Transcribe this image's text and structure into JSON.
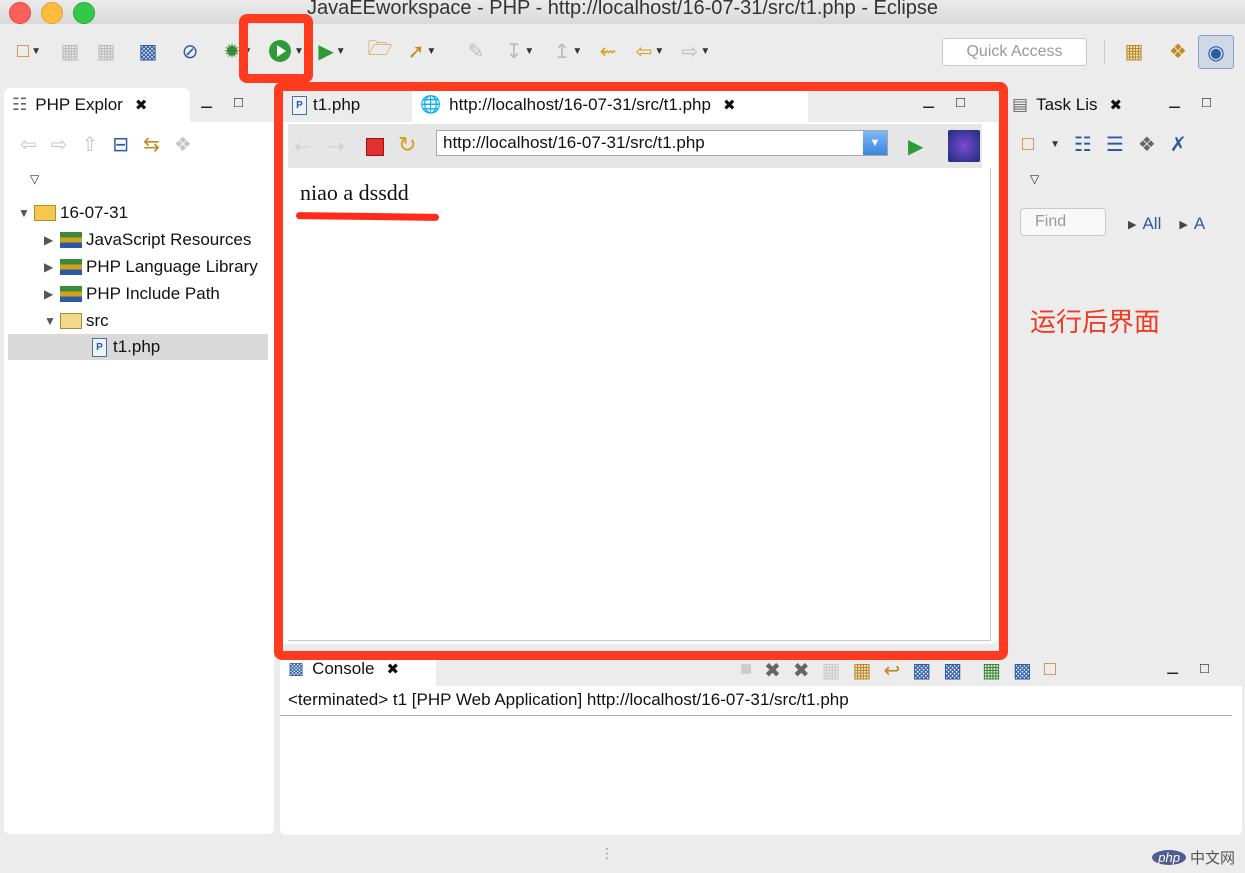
{
  "window": {
    "title": "JavaEEworkspace - PHP - http://localhost/16-07-31/src/t1.php - Eclipse"
  },
  "toolbar": {
    "quick_access_placeholder": "Quick Access"
  },
  "explorer": {
    "title": "PHP Explor",
    "project": "16-07-31",
    "items": [
      {
        "label": "JavaScript Resources"
      },
      {
        "label": "PHP Language Library"
      },
      {
        "label": "PHP Include Path"
      },
      {
        "label": "src"
      },
      {
        "label": "t1.php"
      }
    ]
  },
  "editor": {
    "tabs": [
      {
        "label": "t1.php"
      },
      {
        "label": "http://localhost/16-07-31/src/t1.php"
      }
    ],
    "url": "http://localhost/16-07-31/src/t1.php",
    "page_text": "niao a dssdd"
  },
  "tasklist": {
    "title": "Task Lis",
    "find_placeholder": "Find",
    "filter_all": "All",
    "filter_a": "A"
  },
  "annotation": {
    "text": "运行后界面"
  },
  "console": {
    "title": "Console",
    "line": "<terminated> t1 [PHP Web Application] http://localhost/16-07-31/src/t1.php"
  },
  "watermark": {
    "logo": "php",
    "text": "中文网"
  },
  "colors": {
    "highlight": "#ff3b1f",
    "annotation": "#f03a22"
  }
}
